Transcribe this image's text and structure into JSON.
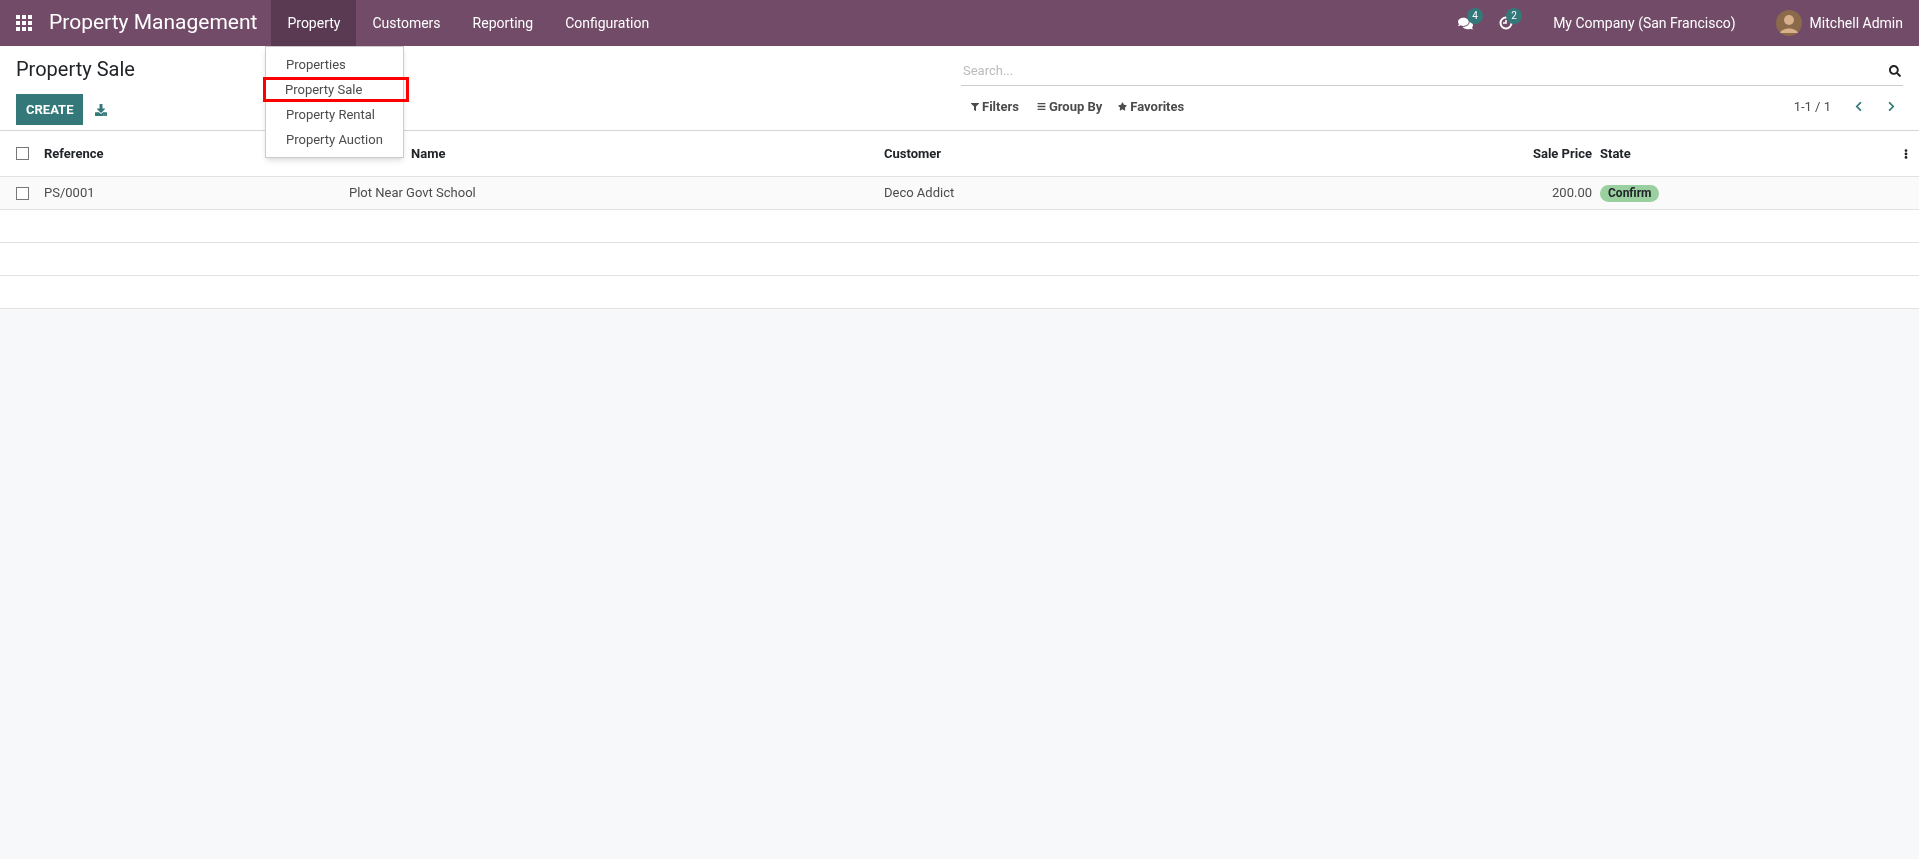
{
  "navbar": {
    "app_title": "Property Management",
    "menu": [
      {
        "label": "Property",
        "selected": true
      },
      {
        "label": "Customers",
        "selected": false
      },
      {
        "label": "Reporting",
        "selected": false
      },
      {
        "label": "Configuration",
        "selected": false
      }
    ],
    "messages_badge": "4",
    "activities_badge": "2",
    "company": "My Company (San Francisco)",
    "user": "Mitchell Admin"
  },
  "dropdown": {
    "items": [
      {
        "label": "Properties",
        "highlighted": false
      },
      {
        "label": "Property Sale",
        "highlighted": true
      },
      {
        "label": "Property Rental",
        "highlighted": false
      },
      {
        "label": "Property Auction",
        "highlighted": false
      }
    ]
  },
  "control_panel": {
    "title": "Property Sale",
    "create_button": "CREATE",
    "search": {
      "placeholder": "Search..."
    },
    "filters": "Filters",
    "group_by": "Group By",
    "favorites": "Favorites",
    "pager": "1-1 / 1"
  },
  "table": {
    "columns": [
      "Reference",
      "Name",
      "Customer",
      "Sale Price",
      "State"
    ],
    "rows": [
      {
        "checked": false,
        "reference": "PS/0001",
        "property_name": "Plot Near Govt School",
        "customer": "Deco Addict",
        "sale_price": "200.00",
        "state": "Confirm",
        "color": "#9ad0a0"
      }
    ],
    "header_checked": false
  }
}
